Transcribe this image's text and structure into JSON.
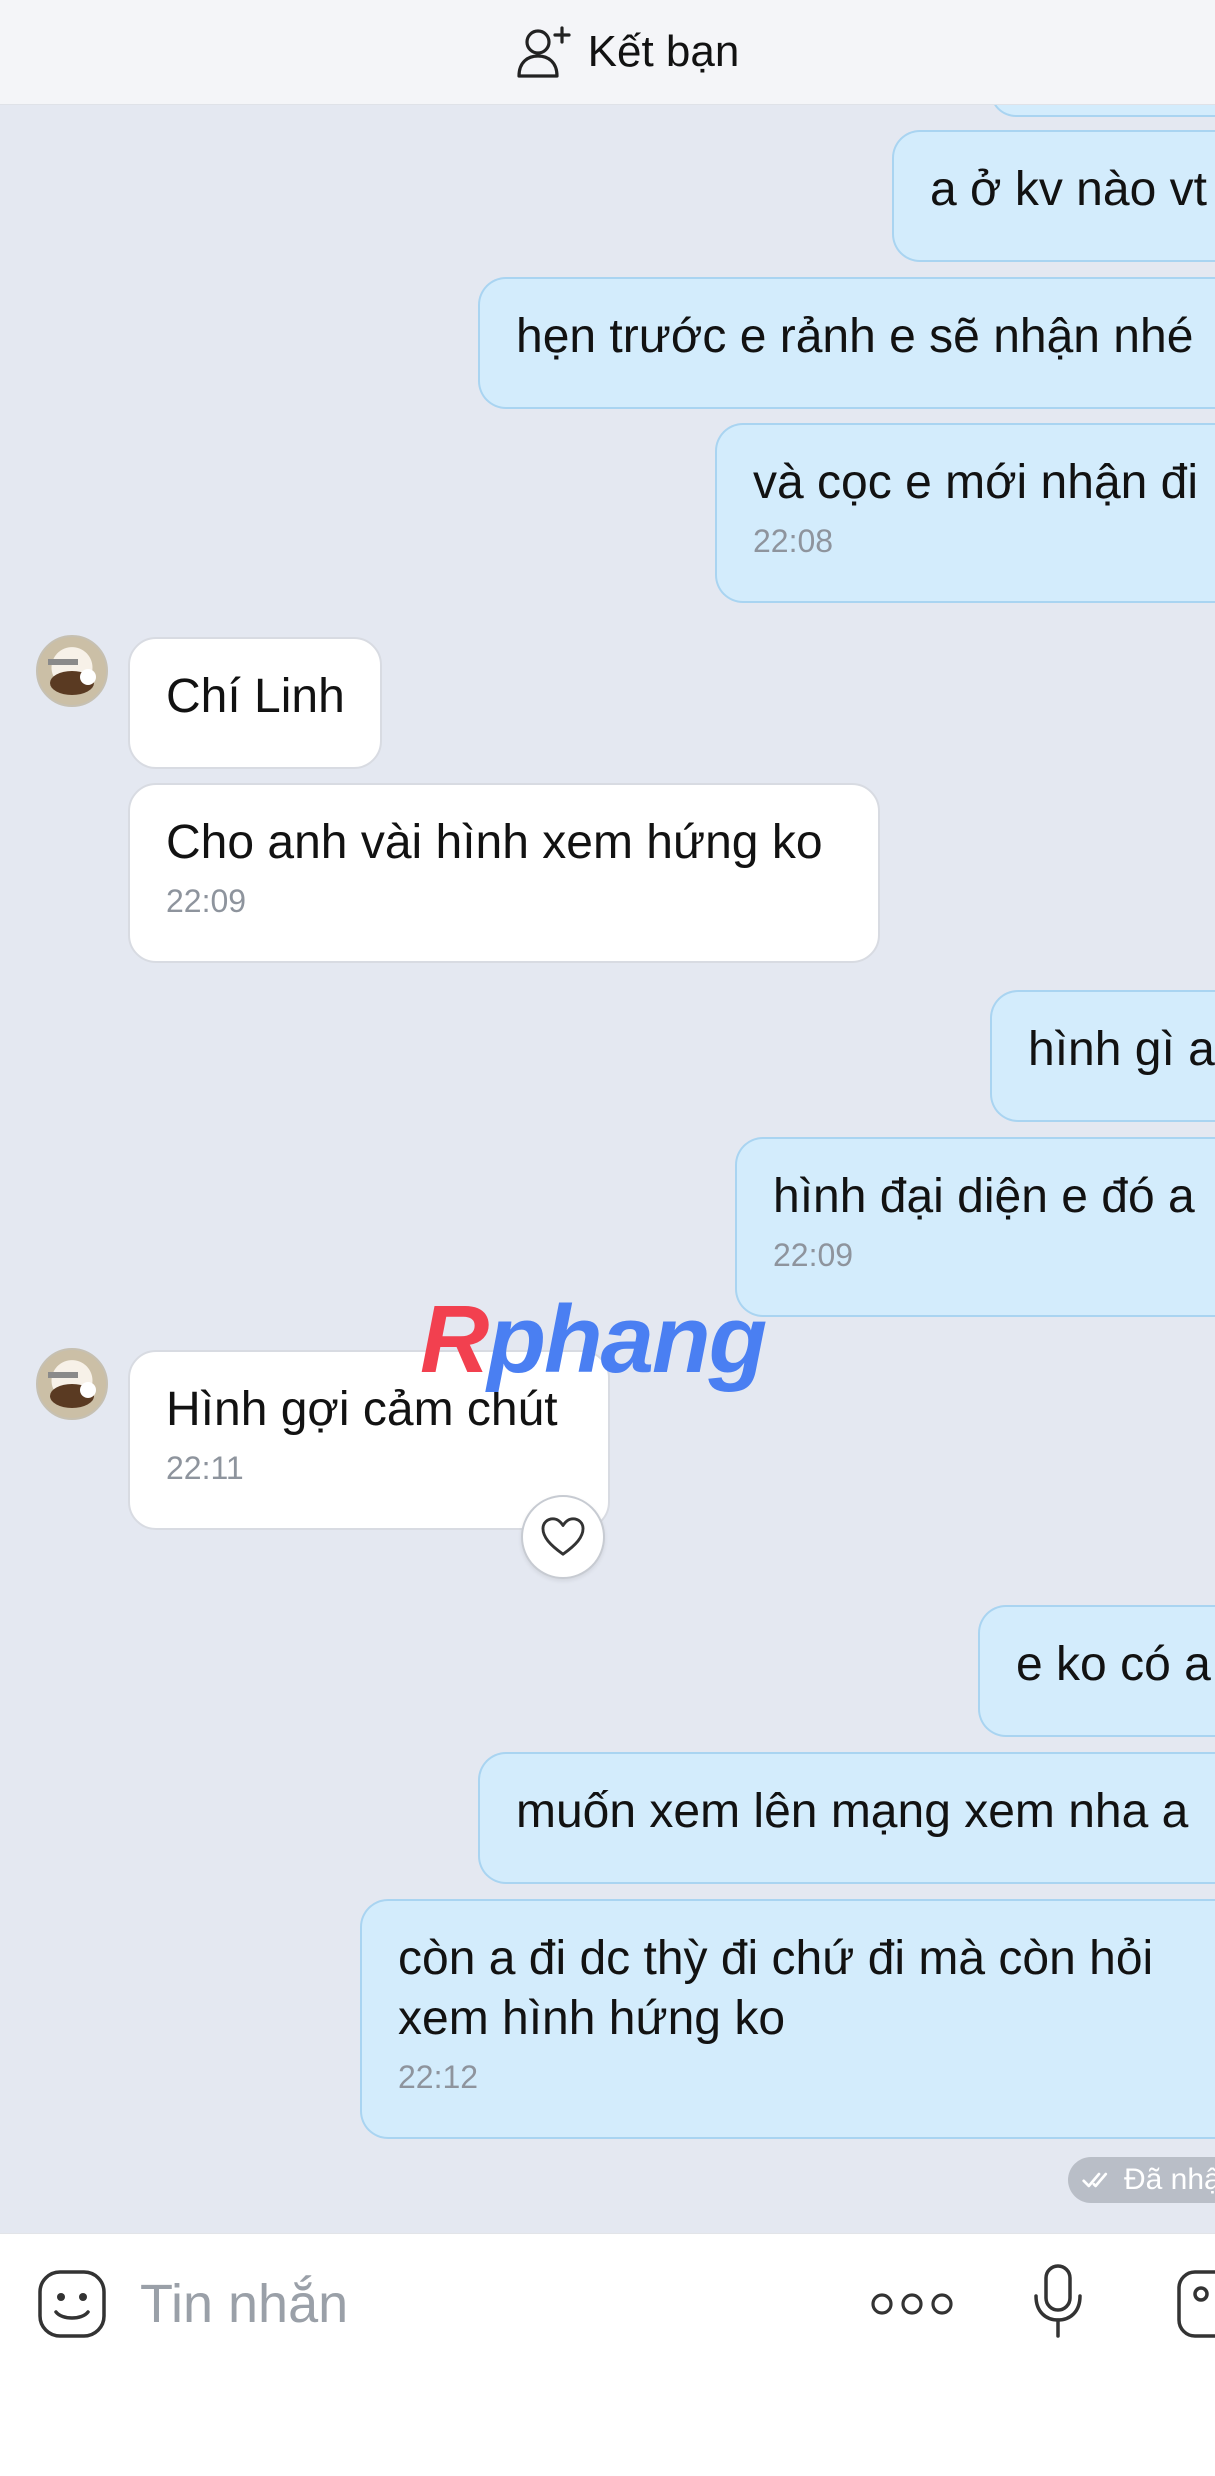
{
  "header": {
    "add_friend_label": "Kết bạn"
  },
  "messages": [
    {
      "text": "a ở kv nào vt"
    },
    {
      "text": "hẹn trước e rảnh e sẽ nhận nhé"
    },
    {
      "text": "và cọc e mới nhận đi",
      "time": "22:08"
    },
    {
      "text": "Chí Linh"
    },
    {
      "text": "Cho anh vài hình xem hứng ko",
      "time": "22:09"
    },
    {
      "text": "hình gì a"
    },
    {
      "text": "hình đại diện e đó a",
      "time": "22:09"
    },
    {
      "text": "Hình gợi cảm chút",
      "time": "22:11"
    },
    {
      "text": "e ko có a"
    },
    {
      "text": "muốn xem lên mạng xem nha a"
    },
    {
      "line1": "còn a đi dc thỳ đi chứ đi mà còn hỏi",
      "line2": "xem hình hứng ko",
      "time": "22:12"
    }
  ],
  "seen_label": "Đã nhận",
  "watermark": {
    "part1": "R",
    "part2": "phang"
  },
  "input": {
    "placeholder": "Tin nhắn"
  },
  "icons": {
    "add_friend": "person-plus-icon",
    "heart": "heart-icon",
    "emoji": "emoji-icon",
    "more": "more-icon",
    "mic": "microphone-icon",
    "image": "image-icon"
  },
  "colors": {
    "outgoing_bubble": "#d3ecfc",
    "incoming_bubble": "#ffffff",
    "chat_background": "#e4e8f1"
  }
}
